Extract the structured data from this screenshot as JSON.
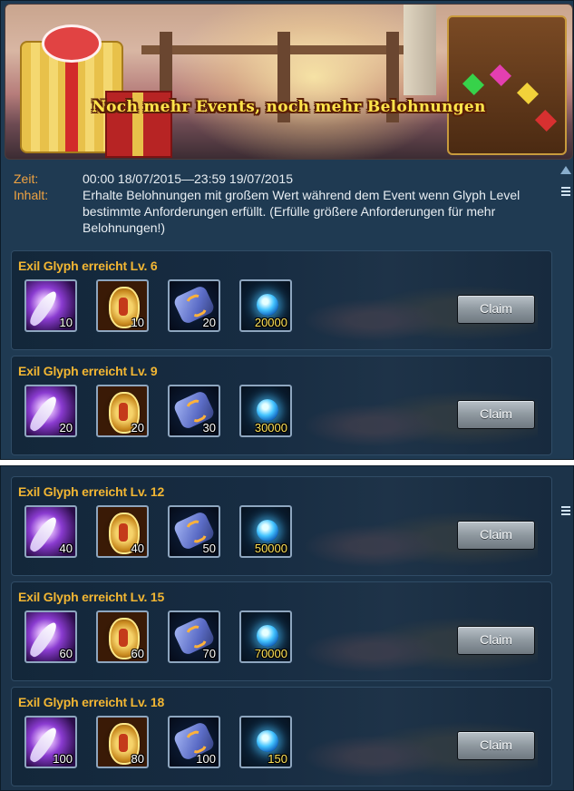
{
  "banner": {
    "title": "Noch mehr Events, noch mehr Belohnungen"
  },
  "event": {
    "time_label": "Zeit:",
    "time_value": "00:00 18/07/2015—23:59 19/07/2015",
    "content_label": "Inhalt:",
    "content_value": "Erhalte Belohnungen mit großem Wert während dem Event wenn Glyph Level bestimmte Anforderungen erfüllt. (Erfülle größere Anforderungen für mehr Belohnungen!)"
  },
  "claim_label": "Claim",
  "tiers_top": [
    {
      "title": "Exil Glyph erreicht Lv. 6",
      "items": [
        {
          "icon": "feather-icon",
          "qty": "10"
        },
        {
          "icon": "rune-icon",
          "qty": "10"
        },
        {
          "icon": "glyph-stone-icon",
          "qty": "20"
        },
        {
          "icon": "orb-icon",
          "qty": "20000"
        }
      ]
    },
    {
      "title": "Exil Glyph erreicht Lv. 9",
      "items": [
        {
          "icon": "feather-icon",
          "qty": "20"
        },
        {
          "icon": "rune-icon",
          "qty": "20"
        },
        {
          "icon": "glyph-stone-icon",
          "qty": "30"
        },
        {
          "icon": "orb-icon",
          "qty": "30000"
        }
      ]
    }
  ],
  "tiers_bottom": [
    {
      "title": "Exil Glyph erreicht Lv. 12",
      "items": [
        {
          "icon": "feather-icon",
          "qty": "40"
        },
        {
          "icon": "rune-icon",
          "qty": "40"
        },
        {
          "icon": "glyph-stone-icon",
          "qty": "50"
        },
        {
          "icon": "orb-icon",
          "qty": "50000"
        }
      ]
    },
    {
      "title": "Exil Glyph erreicht Lv. 15",
      "items": [
        {
          "icon": "feather-icon",
          "qty": "60"
        },
        {
          "icon": "rune-icon",
          "qty": "60"
        },
        {
          "icon": "glyph-stone-icon",
          "qty": "70"
        },
        {
          "icon": "orb-icon",
          "qty": "70000"
        }
      ]
    },
    {
      "title": "Exil Glyph erreicht Lv. 18",
      "items": [
        {
          "icon": "feather-icon",
          "qty": "100"
        },
        {
          "icon": "rune-icon",
          "qty": "80"
        },
        {
          "icon": "glyph-stone-icon",
          "qty": "100"
        },
        {
          "icon": "orb-icon",
          "qty": "150"
        }
      ]
    }
  ]
}
